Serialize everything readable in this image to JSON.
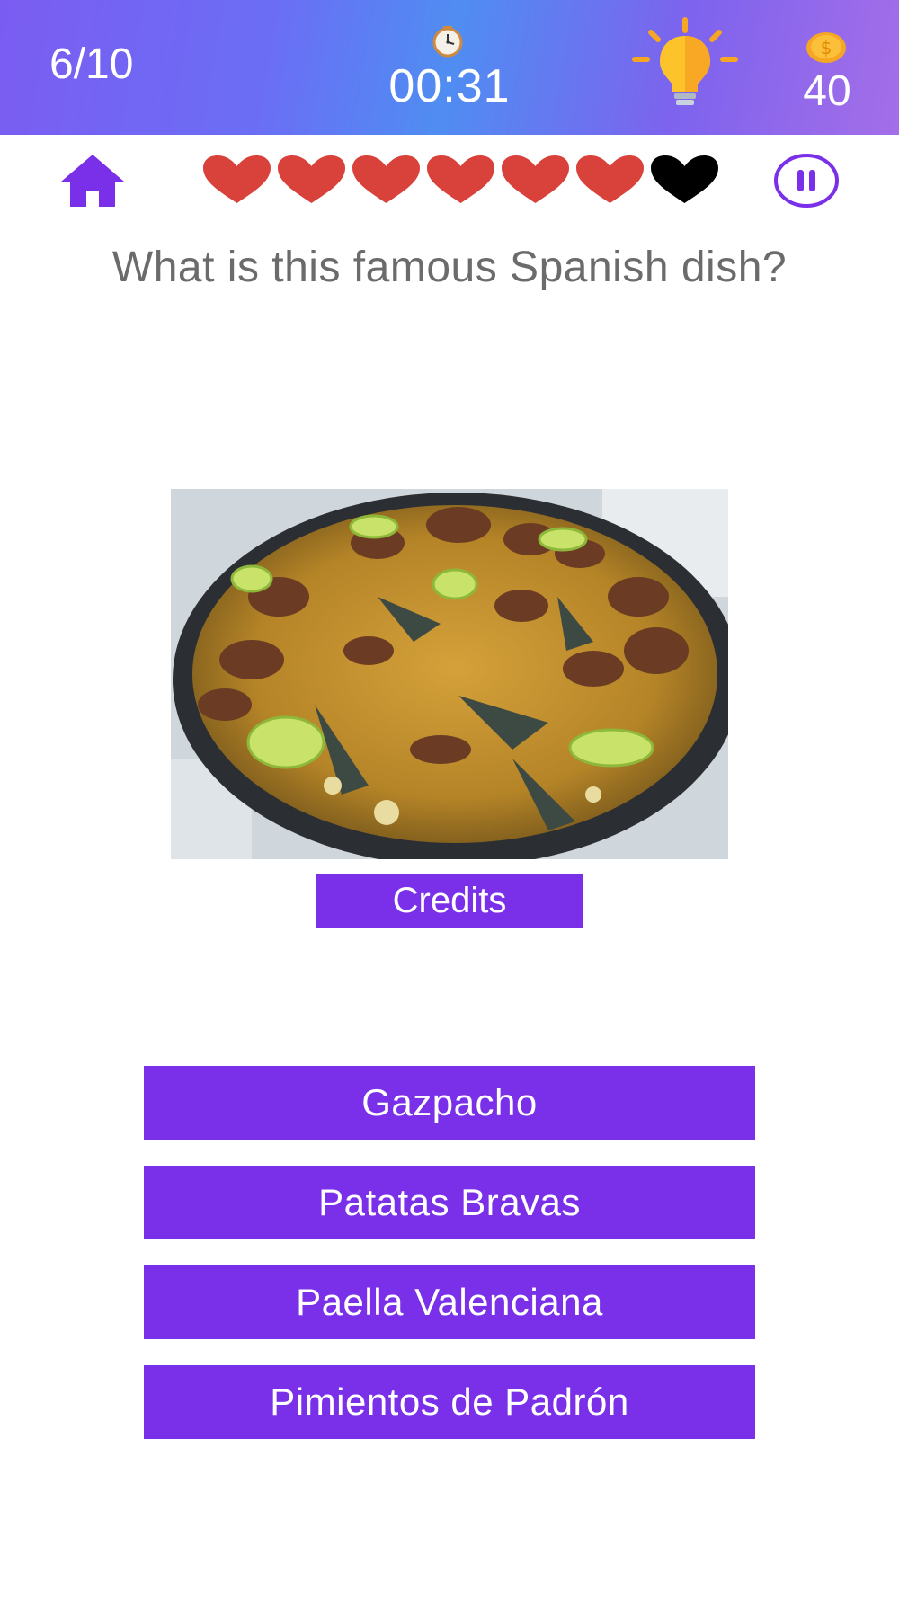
{
  "header": {
    "progress": "6/10",
    "timer": "00:31",
    "coins": "40",
    "icons": [
      "clock-icon",
      "lightbulb-icon",
      "coin-icon"
    ],
    "gradient_colors": [
      "#7b5cf2",
      "#4f8df2",
      "#a46ee8"
    ]
  },
  "toolbar": {
    "icons": [
      "home-icon",
      "heart-icon",
      "pause-icon"
    ],
    "lives_total": 7,
    "lives_remaining": 6,
    "life_color": "#d9423a",
    "lost_life_color": "#000000",
    "accent_color": "#7a2fe8"
  },
  "question": {
    "text": "What is this famous Spanish dish?"
  },
  "image": {
    "content": "paella-photo"
  },
  "credits": {
    "label": "Credits"
  },
  "answers": [
    {
      "label": "Gazpacho"
    },
    {
      "label": "Patatas Bravas"
    },
    {
      "label": "Paella Valenciana"
    },
    {
      "label": "Pimientos de Padrón"
    }
  ]
}
